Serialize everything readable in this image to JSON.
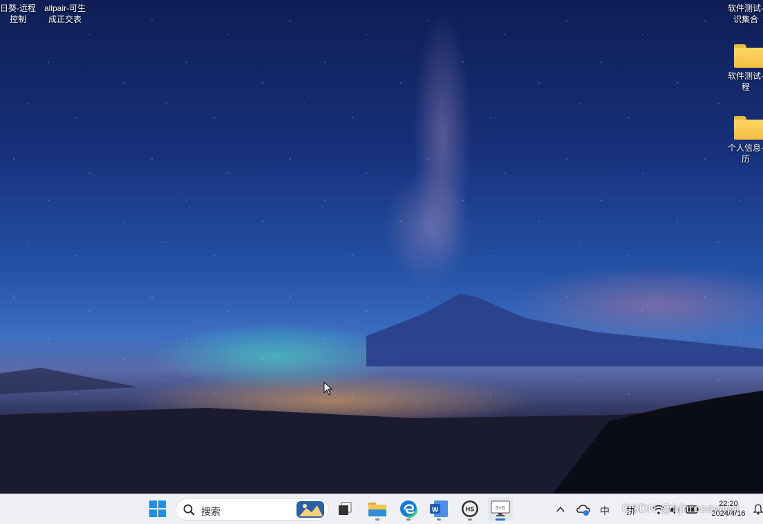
{
  "desktop": {
    "icons_left": [
      {
        "label_line1": "日葵-远程",
        "label_line2": "控制"
      },
      {
        "label_line1": "allpair-可生",
        "label_line2": "成正交表"
      }
    ],
    "icons_right": [
      {
        "label_line1": "软件测试-",
        "label_line2": "识集合"
      },
      {
        "label_line1": "软件测试-",
        "label_line2": "程"
      },
      {
        "label_line1": "个人信息-",
        "label_line2": "历"
      }
    ]
  },
  "taskbar": {
    "search_label": "搜索",
    "apps": [
      {
        "name": "task-view"
      },
      {
        "name": "file-explorer"
      },
      {
        "name": "edge"
      },
      {
        "name": "word",
        "glyph": "W"
      },
      {
        "name": "hs",
        "glyph": "HS"
      },
      {
        "name": "remote-screen",
        "glyph": "S>G",
        "active": true
      }
    ],
    "tray": {
      "ime_lang": "中",
      "ime_mode": "拼",
      "clock_time": "22:20",
      "clock_date": "2024/4/16"
    },
    "watermark": "CSDN @hjhrosewind"
  },
  "colors": {
    "taskbar_bg": "#eef0f4",
    "accent": "#1f6fd1",
    "folder": "#f2bf3e"
  }
}
